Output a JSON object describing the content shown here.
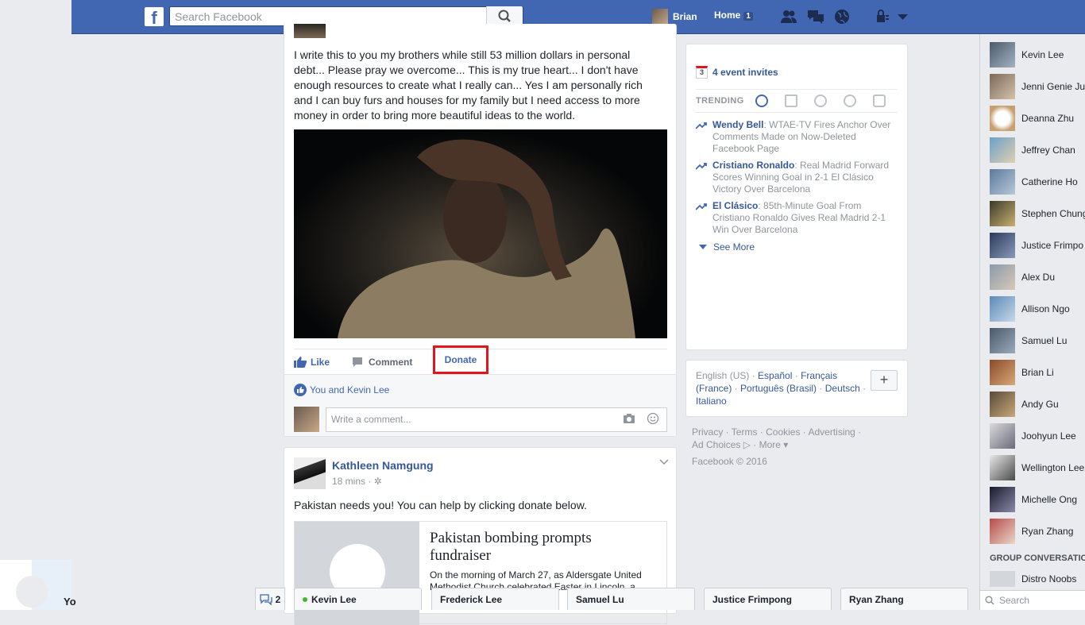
{
  "topbar": {
    "search_placeholder": "Search Facebook",
    "profile_name": "Brian",
    "home_label": "Home",
    "home_badge": "1"
  },
  "post1": {
    "text": "I write this to you my brothers while still 53 million dollars in personal debt... Please pray we overcome... This is my true heart... I don't have enough resources to create what I really can... Yes I am personally rich and I can buy furs and houses for my family but I need access to more money in order to bring more beautiful ideas to the world.",
    "actions": {
      "like": "Like",
      "comment": "Comment",
      "donate": "Donate"
    },
    "likes_text": "You and Kevin Lee",
    "comment_placeholder": "Write a comment..."
  },
  "post2": {
    "author": "Kathleen Namgung",
    "time": "18 mins",
    "text": "Pakistan needs you! You can help by clicking donate below.",
    "link_title": "Pakistan bombing prompts fundraiser",
    "link_desc": "On the morning of March 27, as Aldersgate United Methodist Church celebrated Easter in Lincoln, a"
  },
  "right": {
    "event_count": "3",
    "events_label": "4 event invites",
    "trending_label": "TRENDING",
    "trends": [
      {
        "name": "Wendy Bell",
        "desc": ": WTAE-TV Fires Anchor Over Comments Made on Now-Deleted Facebook Page"
      },
      {
        "name": "Cristiano Ronaldo",
        "desc": ": Real Madrid Forward Scores Winning Goal in 2-1 El Clásico Victory Over Barcelona"
      },
      {
        "name": "El Clásico",
        "desc": ": 85th-Minute Goal From Cristiano Ronaldo Gives Real Madrid 2-1 Win Over Barcelona"
      }
    ],
    "see_more": "See More",
    "languages": {
      "current": "English (US)",
      "others": [
        "Español",
        "Français (France)",
        "Português (Brasil)",
        "Deutsch",
        "Italiano"
      ]
    },
    "footer": {
      "line1": "Privacy · Terms · Cookies · Advertising ·",
      "line2": "Ad Choices ▷ · More ▾",
      "copyright": "Facebook © 2016"
    }
  },
  "chat": {
    "friends": [
      "Kevin Lee",
      "Jenni Genie Ju",
      "Deanna Zhu",
      "Jeffrey Chan",
      "Catherine Ho",
      "Stephen Chung",
      "Justice Frimpo",
      "Alex Du",
      "Allison Ngo",
      "Samuel Lu",
      "Brian Li",
      "Andy Gu",
      "Joohyun Lee",
      "Wellington Lee",
      "Michelle Ong",
      "Ryan Zhang"
    ],
    "group_header": "GROUP CONVERSATIONS",
    "group_first": "Distro Noobs",
    "search_placeholder": "Search",
    "tab_count": "2",
    "tabs": [
      "Kevin Lee",
      "Frederick Lee",
      "Samuel Lu",
      "Justice Frimpong",
      "Ryan Zhang"
    ]
  },
  "left_stub_text": "Yo",
  "colors": {
    "brand": "#4267b2",
    "link": "#365899",
    "highlight": "#e0151e",
    "online": "#42b72a"
  }
}
